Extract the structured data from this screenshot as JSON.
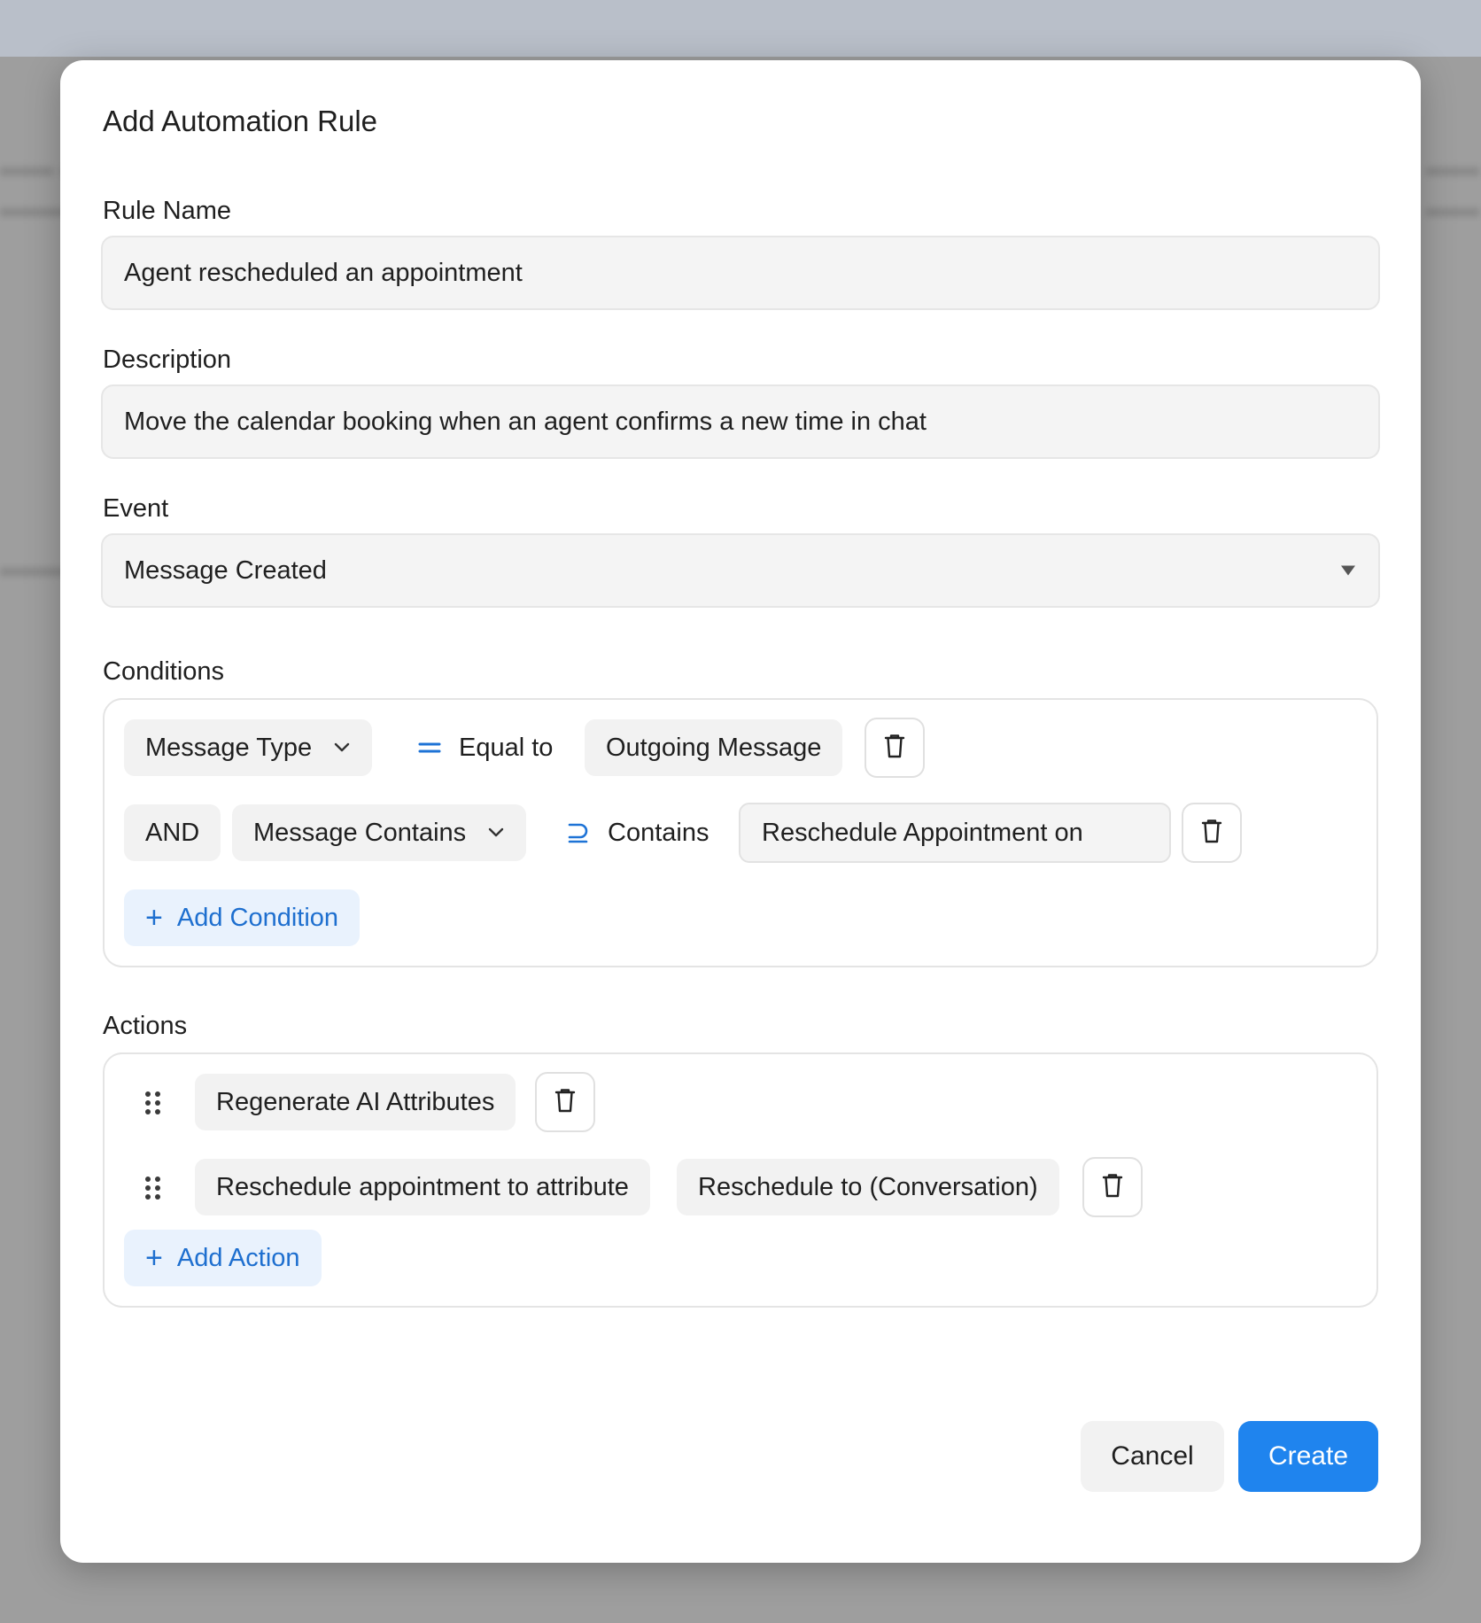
{
  "dialog": {
    "title": "Add Automation Rule"
  },
  "rule_name": {
    "label": "Rule Name",
    "value": "Agent rescheduled an appointment"
  },
  "description": {
    "label": "Description",
    "value": "Move the calendar booking when an agent confirms a new time in chat"
  },
  "event": {
    "label": "Event",
    "value": "Message Created"
  },
  "conditions": {
    "label": "Conditions",
    "rows": [
      {
        "attribute": "Message Type",
        "operator": "Equal to",
        "operator_symbol": "=",
        "value": "Outgoing Message"
      },
      {
        "conjunction": "AND",
        "attribute": "Message Contains",
        "operator": "Contains",
        "operator_symbol": "⊇",
        "value": "Reschedule Appointment on"
      }
    ],
    "add_label": "Add Condition"
  },
  "actions": {
    "label": "Actions",
    "rows": [
      {
        "action": "Regenerate AI Attributes"
      },
      {
        "action": "Reschedule appointment to attribute",
        "param": "Reschedule to (Conversation)"
      }
    ],
    "add_label": "Add Action"
  },
  "footer": {
    "cancel_label": "Cancel",
    "create_label": "Create"
  },
  "colors": {
    "primary": "#1f84ee",
    "link": "#1e6fcf",
    "add_bg": "#e9f2fd"
  }
}
